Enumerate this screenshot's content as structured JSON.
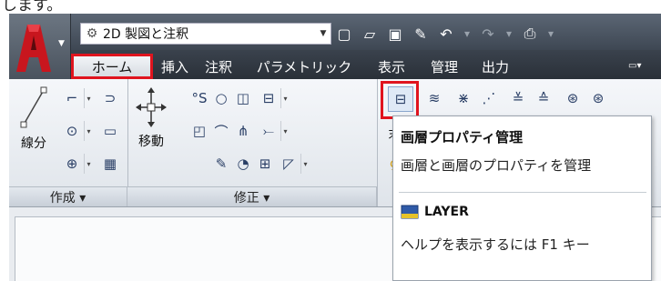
{
  "caption": "します。",
  "workspace": {
    "label": "2D 製図と注釈",
    "icon": "gear-icon"
  },
  "tabs": [
    {
      "label": "ホーム",
      "active": true
    },
    {
      "label": "挿入",
      "active": false
    },
    {
      "label": "注釈",
      "active": false
    },
    {
      "label": "パラメトリック",
      "active": false
    },
    {
      "label": "表示",
      "active": false
    },
    {
      "label": "管理",
      "active": false
    },
    {
      "label": "出力",
      "active": false
    }
  ],
  "panels": {
    "create": {
      "title": "作成 ▾",
      "big_tool": "線分"
    },
    "modify": {
      "title": "修正 ▾",
      "big_tool": "移動"
    }
  },
  "layers_panel": {
    "partial_text": "末"
  },
  "tooltip": {
    "title": "画層プロパティ管理",
    "description": "画層と画層のプロパティを管理",
    "command": "LAYER",
    "help": "ヘルプを表示するには F1 キー"
  },
  "colors": {
    "highlight": "#e0141e",
    "title_bar": "#4a535e",
    "ribbon": "#eef1f5"
  }
}
